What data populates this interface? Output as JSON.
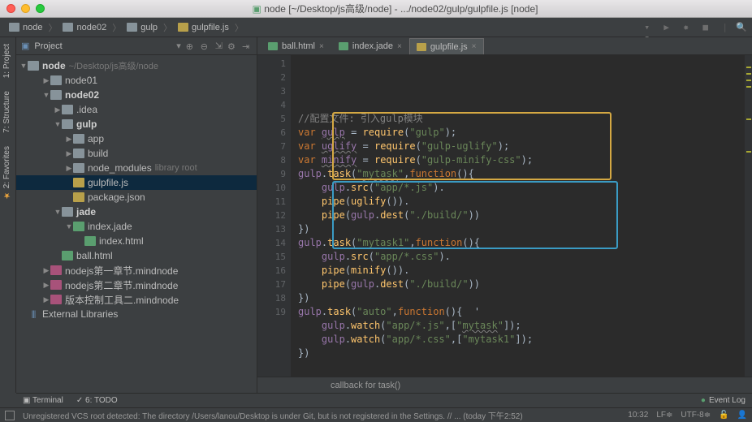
{
  "window": {
    "title": "node [~/Desktop/js高级/node] - .../node02/gulp/gulpfile.js [node]"
  },
  "breadcrumbs": [
    "node",
    "node02",
    "gulp",
    "gulpfile.js"
  ],
  "left_tabs": {
    "project": "1: Project",
    "structure": "7: Structure",
    "favorites": "2: Favorites"
  },
  "project_panel": {
    "title": "Project"
  },
  "tree": {
    "root": {
      "name": "node",
      "path": "~/Desktop/js高级/node"
    },
    "items": [
      {
        "name": "node01",
        "indent": 2,
        "arrow": "▶",
        "type": "folder"
      },
      {
        "name": "node02",
        "indent": 2,
        "arrow": "▼",
        "type": "folder",
        "bold": true
      },
      {
        "name": ".idea",
        "indent": 3,
        "arrow": "▶",
        "type": "folder"
      },
      {
        "name": "gulp",
        "indent": 3,
        "arrow": "▼",
        "type": "folder",
        "bold": true
      },
      {
        "name": "app",
        "indent": 4,
        "arrow": "▶",
        "type": "folder"
      },
      {
        "name": "build",
        "indent": 4,
        "arrow": "▶",
        "type": "folder"
      },
      {
        "name": "node_modules",
        "indent": 4,
        "arrow": "▶",
        "type": "folder",
        "note": "library root"
      },
      {
        "name": "gulpfile.js",
        "indent": 4,
        "arrow": "",
        "type": "jsfile",
        "selected": true
      },
      {
        "name": "package.json",
        "indent": 4,
        "arrow": "",
        "type": "jsfile"
      },
      {
        "name": "jade",
        "indent": 3,
        "arrow": "▼",
        "type": "folder",
        "bold": true
      },
      {
        "name": "index.jade",
        "indent": 4,
        "arrow": "▼",
        "type": "jadefile"
      },
      {
        "name": "index.html",
        "indent": 5,
        "arrow": "",
        "type": "htmlfile"
      },
      {
        "name": "ball.html",
        "indent": 3,
        "arrow": "",
        "type": "htmlfile"
      },
      {
        "name": "nodejs第一章节.mindnode",
        "indent": 2,
        "arrow": "▶",
        "type": "mindfile"
      },
      {
        "name": "nodejs第二章节.mindnode",
        "indent": 2,
        "arrow": "▶",
        "type": "mindfile"
      },
      {
        "name": "版本控制工具二.mindnode",
        "indent": 2,
        "arrow": "▶",
        "type": "mindfile"
      }
    ],
    "external": "External Libraries"
  },
  "editor_tabs": [
    {
      "label": "ball.html",
      "type": "htmlfile",
      "active": false
    },
    {
      "label": "index.jade",
      "type": "jadefile",
      "active": false
    },
    {
      "label": "gulpfile.js",
      "type": "jsfile",
      "active": true
    }
  ],
  "code": {
    "lines": [
      {
        "n": 1,
        "html": "<span class='c-comment'>//配置文件: 引入gulp模块</span>"
      },
      {
        "n": 2,
        "html": "<span class='c-kw'>var</span> <span class='c-var underline-err'>gulp</span> <span class='c-punc'>=</span> <span class='c-call'>require</span><span class='c-punc'>(</span><span class='c-str'>\"gulp\"</span><span class='c-punc'>);</span>"
      },
      {
        "n": 3,
        "html": "<span class='c-kw'>var</span> <span class='c-var underline-err'>uglify</span> <span class='c-punc'>=</span> <span class='c-call'>require</span><span class='c-punc'>(</span><span class='c-str'>\"gulp-uglify\"</span><span class='c-punc'>);</span>"
      },
      {
        "n": 4,
        "html": "<span class='c-kw'>var</span> <span class='c-var underline-err'>minify</span> <span class='c-punc'>=</span> <span class='c-call'>require</span><span class='c-punc'>(</span><span class='c-str'>\"gulp-minify-css\"</span><span class='c-punc'>);</span>"
      },
      {
        "n": 5,
        "html": "<span class='c-var'>gulp</span><span class='c-punc'>.</span><span class='c-call'>task</span><span class='c-punc'>(</span><span class='c-str'>\"<span class='underline-err'>mytask</span>\"</span><span class='c-punc'>,</span><span class='c-kw'>function</span><span class='c-punc'>(){</span>"
      },
      {
        "n": 6,
        "html": "    <span class='c-var'>gulp</span><span class='c-punc'>.</span><span class='c-call'>src</span><span class='c-punc'>(</span><span class='c-str'>\"app/*.js\"</span><span class='c-punc'>).</span>"
      },
      {
        "n": 7,
        "html": "    <span class='c-call'>pipe</span><span class='c-punc'>(</span><span class='c-call'>uglify</span><span class='c-punc'>()).</span>"
      },
      {
        "n": 8,
        "html": "    <span class='c-call'>pipe</span><span class='c-punc'>(</span><span class='c-var'>gulp</span><span class='c-punc'>.</span><span class='c-call'>dest</span><span class='c-punc'>(</span><span class='c-str'>\"./build/\"</span><span class='c-punc'>))</span>"
      },
      {
        "n": 9,
        "html": "<span class='c-punc'>})</span>"
      },
      {
        "n": 10,
        "html": "<span class='c-var'>gulp</span><span class='c-punc'>.</span><span class='c-call'>task</span><span class='c-punc'>(</span><span class='c-str'>\"mytask1\"</span><span class='c-punc'>,</span><span class='c-kw'>function</span><span class='c-punc'>(){</span>"
      },
      {
        "n": 11,
        "html": "    <span class='c-var'>gulp</span><span class='c-punc'>.</span><span class='c-call'>src</span><span class='c-punc'>(</span><span class='c-str'>\"app/*.css\"</span><span class='c-punc'>).</span>"
      },
      {
        "n": 12,
        "html": "    <span class='c-call'>pipe</span><span class='c-punc'>(</span><span class='c-call'>minify</span><span class='c-punc'>()).</span>"
      },
      {
        "n": 13,
        "html": "    <span class='c-call'>pipe</span><span class='c-punc'>(</span><span class='c-var'>gulp</span><span class='c-punc'>.</span><span class='c-call'>dest</span><span class='c-punc'>(</span><span class='c-str'>\"./build/\"</span><span class='c-punc'>))</span>"
      },
      {
        "n": 14,
        "html": "<span class='c-punc'>})</span>"
      },
      {
        "n": 15,
        "html": "<span class='c-var'>gulp</span><span class='c-punc'>.</span><span class='c-call'>task</span><span class='c-punc'>(</span><span class='c-str'>\"auto\"</span><span class='c-punc'>,</span><span class='c-kw'>function</span><span class='c-punc'>(){</span>  <span class='c-punc'>'</span>"
      },
      {
        "n": 16,
        "html": "    <span class='c-var'>gulp</span><span class='c-punc'>.</span><span class='c-call'>watch</span><span class='c-punc'>(</span><span class='c-str'>\"app/*.js\"</span><span class='c-punc'>,[</span><span class='c-str'>\"<span class='underline-err'>mytask</span>\"</span><span class='c-punc'>]);</span>"
      },
      {
        "n": 17,
        "html": "    <span class='c-var'>gulp</span><span class='c-punc'>.</span><span class='c-call'>watch</span><span class='c-punc'>(</span><span class='c-str'>\"app/*.css\"</span><span class='c-punc'>,[</span><span class='c-str'>\"mytask1\"</span><span class='c-punc'>]);</span>"
      },
      {
        "n": 18,
        "html": "<span class='c-punc'>})</span>"
      },
      {
        "n": 19,
        "html": ""
      }
    ]
  },
  "breadcrumb_bottom": "callback for task()",
  "bottom_tools": {
    "terminal": "Terminal",
    "todo": "6: TODO",
    "eventlog": "Event Log"
  },
  "statusbar": {
    "message": "Unregistered VCS root detected: The directory /Users/lanou/Desktop is under Git, but is not registered in the Settings. // ... (today 下午2:52)",
    "cursor": "10:32",
    "lineend": "LF≑",
    "encoding": "UTF-8≑",
    "lock": "🔒"
  }
}
